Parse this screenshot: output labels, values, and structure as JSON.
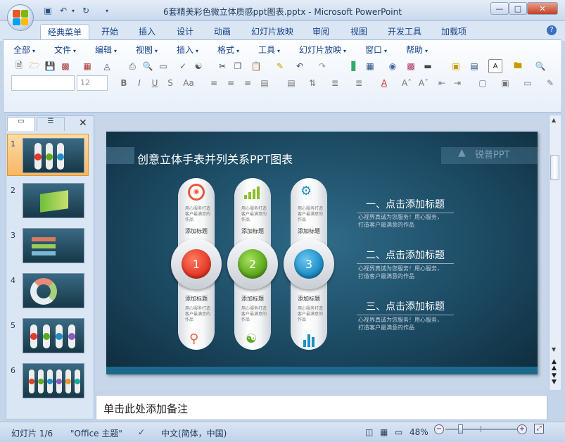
{
  "window": {
    "title": "6套精美彩色微立体质感ppt图表.pptx - Microsoft PowerPoint"
  },
  "ribbon_tabs": [
    {
      "label": "经典菜单",
      "active": true
    },
    {
      "label": "开始"
    },
    {
      "label": "插入"
    },
    {
      "label": "设计"
    },
    {
      "label": "动画"
    },
    {
      "label": "幻灯片放映"
    },
    {
      "label": "审阅"
    },
    {
      "label": "视图"
    },
    {
      "label": "开发工具"
    },
    {
      "label": "加载项"
    }
  ],
  "menus": [
    "全部",
    "文件",
    "编辑",
    "视图",
    "插入",
    "格式",
    "工具",
    "幻灯片放映",
    "窗口",
    "帮助"
  ],
  "font_size_value": "12",
  "thumbnails": [
    {
      "num": "1",
      "selected": true
    },
    {
      "num": "2"
    },
    {
      "num": "3"
    },
    {
      "num": "4"
    },
    {
      "num": "5"
    },
    {
      "num": "6"
    }
  ],
  "slide": {
    "title": "创意立体手表并列关系PPT图表",
    "logo_text": "锐普PPT",
    "pills": [
      {
        "num": "1",
        "color": "#e63b2a",
        "top_text": "用心服务打造客户最满意的作品",
        "top_label": "添加标题",
        "bottom_label": "添加标题",
        "bottom_text": "用心服务打造客户最满意的作品",
        "top_icon": "target-icon",
        "bottom_icon": "magnifier-icon"
      },
      {
        "num": "2",
        "color": "#5ea91e",
        "top_text": "用心服务打造客户最满意的作品",
        "top_label": "添加标题",
        "bottom_label": "添加标题",
        "bottom_text": "用心服务打造客户最满意的作品",
        "top_icon": "bar-chart-icon",
        "bottom_icon": "globe-icon"
      },
      {
        "num": "3",
        "color": "#1f8fc7",
        "top_text": "用心服务打造客户最满意的作品",
        "top_label": "添加标题",
        "bottom_label": "添加标题",
        "bottom_text": "用心服务打造客户最满意的作品",
        "top_icon": "gears-icon",
        "bottom_icon": "bars-icon"
      }
    ],
    "headings": [
      {
        "title": "一、点击添加标题",
        "line1": "心视界真诚为您服务！用心服务，",
        "line2": "打造客户最满意的作品"
      },
      {
        "title": "二、点击添加标题",
        "line1": "心视界真诚为您服务！用心服务，",
        "line2": "打造客户最满意的作品"
      },
      {
        "title": "三、点击添加标题",
        "line1": "心视界真诚为您服务！用心服务，",
        "line2": "打造客户最满意的作品"
      }
    ]
  },
  "notes_placeholder": "单击此处添加备注",
  "status": {
    "slide": "幻灯片 1/6",
    "theme": "\"Office 主题\"",
    "language": "中文(简体，中国)",
    "zoom": "48%"
  }
}
